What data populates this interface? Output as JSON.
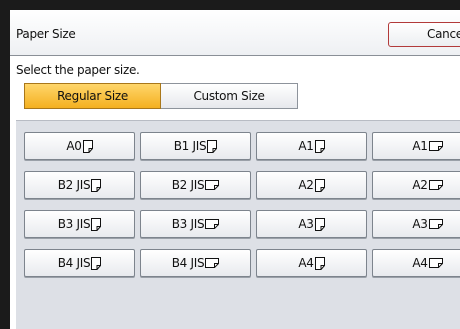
{
  "header": {
    "title": "Paper Size",
    "cancel_label": "Cancel"
  },
  "prompt": "Select the paper size.",
  "tabs": [
    {
      "label": "Regular Size",
      "selected": true
    },
    {
      "label": "Custom Size",
      "selected": false
    }
  ],
  "sizes": [
    {
      "label": "A0",
      "icon": "paper-portrait-icon"
    },
    {
      "label": "B1 JIS",
      "icon": "paper-portrait-icon"
    },
    {
      "label": "A1",
      "icon": "paper-portrait-icon"
    },
    {
      "label": "A1",
      "icon": "paper-landscape-icon"
    },
    {
      "label": "B2 JIS",
      "icon": "paper-portrait-icon"
    },
    {
      "label": "B2 JIS",
      "icon": "paper-landscape-icon"
    },
    {
      "label": "A2",
      "icon": "paper-portrait-icon"
    },
    {
      "label": "A2",
      "icon": "paper-landscape-icon"
    },
    {
      "label": "B3 JIS",
      "icon": "paper-portrait-icon"
    },
    {
      "label": "B3 JIS",
      "icon": "paper-landscape-icon"
    },
    {
      "label": "A3",
      "icon": "paper-portrait-icon"
    },
    {
      "label": "A3",
      "icon": "paper-landscape-icon"
    },
    {
      "label": "B4 JIS",
      "icon": "paper-portrait-icon"
    },
    {
      "label": "B4 JIS",
      "icon": "paper-landscape-icon"
    },
    {
      "label": "A4",
      "icon": "paper-portrait-icon"
    },
    {
      "label": "A4",
      "icon": "paper-landscape-icon"
    }
  ],
  "colors": {
    "selected_tab": "#f4b020",
    "cancel_border": "#b23a3a",
    "panel": "#dde0e6"
  }
}
